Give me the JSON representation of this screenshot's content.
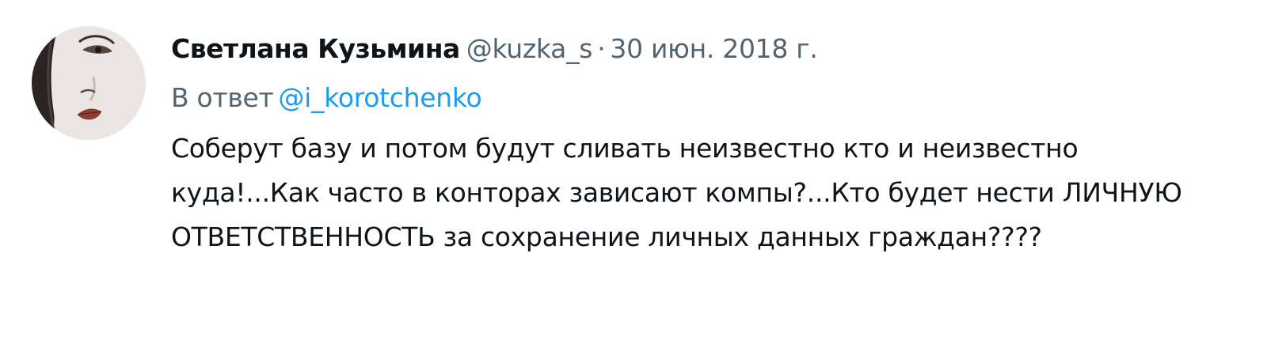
{
  "tweet": {
    "author_name": "Светлана Кузьмина",
    "author_handle": "@kuzka_s",
    "separator": "·",
    "date": "30 июн. 2018 г.",
    "reply_prefix": "В ответ",
    "reply_handle": "@i_korotchenko",
    "text": "Соберут базу и потом будут сливать неизвестно кто и неизвестно куда!...Как часто в конторах зависают компы?...Кто будет нести ЛИЧНУЮ ОТВЕТСТВЕННОСТЬ за сохранение личных данных граждан????",
    "avatar": "avatar-face-illustration"
  },
  "colors": {
    "name": "#0f1419",
    "secondary": "#536471",
    "link": "#1d9bf0",
    "avatar_bg": "#e9e4e3"
  }
}
